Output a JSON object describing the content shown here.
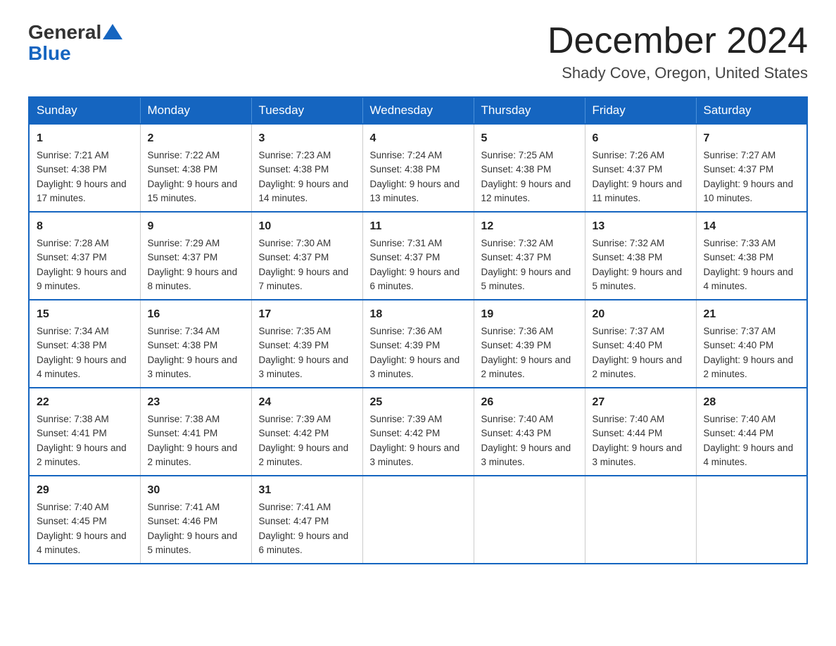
{
  "header": {
    "logo_general": "General",
    "logo_blue": "Blue",
    "month": "December 2024",
    "location": "Shady Cove, Oregon, United States"
  },
  "weekdays": [
    "Sunday",
    "Monday",
    "Tuesday",
    "Wednesday",
    "Thursday",
    "Friday",
    "Saturday"
  ],
  "weeks": [
    [
      {
        "day": "1",
        "sunrise": "7:21 AM",
        "sunset": "4:38 PM",
        "daylight": "9 hours and 17 minutes."
      },
      {
        "day": "2",
        "sunrise": "7:22 AM",
        "sunset": "4:38 PM",
        "daylight": "9 hours and 15 minutes."
      },
      {
        "day": "3",
        "sunrise": "7:23 AM",
        "sunset": "4:38 PM",
        "daylight": "9 hours and 14 minutes."
      },
      {
        "day": "4",
        "sunrise": "7:24 AM",
        "sunset": "4:38 PM",
        "daylight": "9 hours and 13 minutes."
      },
      {
        "day": "5",
        "sunrise": "7:25 AM",
        "sunset": "4:38 PM",
        "daylight": "9 hours and 12 minutes."
      },
      {
        "day": "6",
        "sunrise": "7:26 AM",
        "sunset": "4:37 PM",
        "daylight": "9 hours and 11 minutes."
      },
      {
        "day": "7",
        "sunrise": "7:27 AM",
        "sunset": "4:37 PM",
        "daylight": "9 hours and 10 minutes."
      }
    ],
    [
      {
        "day": "8",
        "sunrise": "7:28 AM",
        "sunset": "4:37 PM",
        "daylight": "9 hours and 9 minutes."
      },
      {
        "day": "9",
        "sunrise": "7:29 AM",
        "sunset": "4:37 PM",
        "daylight": "9 hours and 8 minutes."
      },
      {
        "day": "10",
        "sunrise": "7:30 AM",
        "sunset": "4:37 PM",
        "daylight": "9 hours and 7 minutes."
      },
      {
        "day": "11",
        "sunrise": "7:31 AM",
        "sunset": "4:37 PM",
        "daylight": "9 hours and 6 minutes."
      },
      {
        "day": "12",
        "sunrise": "7:32 AM",
        "sunset": "4:37 PM",
        "daylight": "9 hours and 5 minutes."
      },
      {
        "day": "13",
        "sunrise": "7:32 AM",
        "sunset": "4:38 PM",
        "daylight": "9 hours and 5 minutes."
      },
      {
        "day": "14",
        "sunrise": "7:33 AM",
        "sunset": "4:38 PM",
        "daylight": "9 hours and 4 minutes."
      }
    ],
    [
      {
        "day": "15",
        "sunrise": "7:34 AM",
        "sunset": "4:38 PM",
        "daylight": "9 hours and 4 minutes."
      },
      {
        "day": "16",
        "sunrise": "7:34 AM",
        "sunset": "4:38 PM",
        "daylight": "9 hours and 3 minutes."
      },
      {
        "day": "17",
        "sunrise": "7:35 AM",
        "sunset": "4:39 PM",
        "daylight": "9 hours and 3 minutes."
      },
      {
        "day": "18",
        "sunrise": "7:36 AM",
        "sunset": "4:39 PM",
        "daylight": "9 hours and 3 minutes."
      },
      {
        "day": "19",
        "sunrise": "7:36 AM",
        "sunset": "4:39 PM",
        "daylight": "9 hours and 2 minutes."
      },
      {
        "day": "20",
        "sunrise": "7:37 AM",
        "sunset": "4:40 PM",
        "daylight": "9 hours and 2 minutes."
      },
      {
        "day": "21",
        "sunrise": "7:37 AM",
        "sunset": "4:40 PM",
        "daylight": "9 hours and 2 minutes."
      }
    ],
    [
      {
        "day": "22",
        "sunrise": "7:38 AM",
        "sunset": "4:41 PM",
        "daylight": "9 hours and 2 minutes."
      },
      {
        "day": "23",
        "sunrise": "7:38 AM",
        "sunset": "4:41 PM",
        "daylight": "9 hours and 2 minutes."
      },
      {
        "day": "24",
        "sunrise": "7:39 AM",
        "sunset": "4:42 PM",
        "daylight": "9 hours and 2 minutes."
      },
      {
        "day": "25",
        "sunrise": "7:39 AM",
        "sunset": "4:42 PM",
        "daylight": "9 hours and 3 minutes."
      },
      {
        "day": "26",
        "sunrise": "7:40 AM",
        "sunset": "4:43 PM",
        "daylight": "9 hours and 3 minutes."
      },
      {
        "day": "27",
        "sunrise": "7:40 AM",
        "sunset": "4:44 PM",
        "daylight": "9 hours and 3 minutes."
      },
      {
        "day": "28",
        "sunrise": "7:40 AM",
        "sunset": "4:44 PM",
        "daylight": "9 hours and 4 minutes."
      }
    ],
    [
      {
        "day": "29",
        "sunrise": "7:40 AM",
        "sunset": "4:45 PM",
        "daylight": "9 hours and 4 minutes."
      },
      {
        "day": "30",
        "sunrise": "7:41 AM",
        "sunset": "4:46 PM",
        "daylight": "9 hours and 5 minutes."
      },
      {
        "day": "31",
        "sunrise": "7:41 AM",
        "sunset": "4:47 PM",
        "daylight": "9 hours and 6 minutes."
      },
      null,
      null,
      null,
      null
    ]
  ],
  "labels": {
    "sunrise": "Sunrise:",
    "sunset": "Sunset:",
    "daylight": "Daylight:"
  }
}
